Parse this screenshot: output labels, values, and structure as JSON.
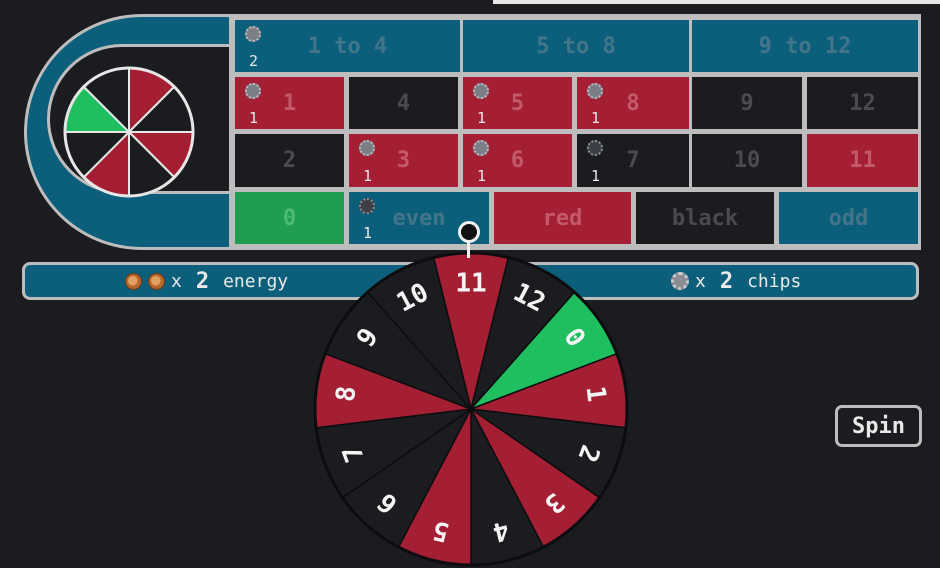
{
  "board": {
    "dozens": [
      {
        "label": "1 to 4",
        "chips": "2"
      },
      {
        "label": "5 to 8",
        "chips": ""
      },
      {
        "label": "9 to 12",
        "chips": ""
      }
    ],
    "numbers": [
      {
        "label": "1",
        "color": "red",
        "chips": "1"
      },
      {
        "label": "4",
        "color": "black",
        "chips": ""
      },
      {
        "label": "5",
        "color": "red",
        "chips": "1"
      },
      {
        "label": "8",
        "color": "red",
        "chips": "1"
      },
      {
        "label": "9",
        "color": "black",
        "chips": ""
      },
      {
        "label": "12",
        "color": "black",
        "chips": ""
      },
      {
        "label": "2",
        "color": "black",
        "chips": ""
      },
      {
        "label": "3",
        "color": "red",
        "chips": "1"
      },
      {
        "label": "6",
        "color": "red",
        "chips": "1"
      },
      {
        "label": "7",
        "color": "black",
        "chips": "1"
      },
      {
        "label": "10",
        "color": "black",
        "chips": ""
      },
      {
        "label": "11",
        "color": "red",
        "chips": ""
      }
    ],
    "outside": [
      {
        "label": "0",
        "chips": ""
      },
      {
        "label": "even",
        "chips": "1"
      },
      {
        "label": "red",
        "chips": ""
      },
      {
        "label": "black",
        "chips": ""
      },
      {
        "label": "odd",
        "chips": ""
      }
    ]
  },
  "status": {
    "energy_prefix": "x",
    "energy_count": "2",
    "energy_label": "energy",
    "chips_prefix": "x",
    "chips_count": "2",
    "chips_label": "chips"
  },
  "wheel": {
    "pockets": [
      {
        "label": "11",
        "color": "red"
      },
      {
        "label": "12",
        "color": "black"
      },
      {
        "label": "0",
        "color": "green"
      },
      {
        "label": "1",
        "color": "red"
      },
      {
        "label": "2",
        "color": "black"
      },
      {
        "label": "3",
        "color": "red"
      },
      {
        "label": "4",
        "color": "black"
      },
      {
        "label": "5",
        "color": "red"
      },
      {
        "label": "6",
        "color": "black"
      },
      {
        "label": "7",
        "color": "black"
      },
      {
        "label": "8",
        "color": "red"
      },
      {
        "label": "9",
        "color": "black"
      },
      {
        "label": "10",
        "color": "black"
      }
    ]
  },
  "mini_wheel": {
    "segments": [
      "red",
      "black",
      "red",
      "black",
      "red",
      "black",
      "green",
      "black"
    ]
  },
  "controls": {
    "spin_label": "Spin"
  },
  "colors": {
    "red": "#a51f34",
    "black": "#1b1c1f",
    "green": "#1fbf5f",
    "blue": "#0b5f7a",
    "border": "#bdbdbd"
  }
}
